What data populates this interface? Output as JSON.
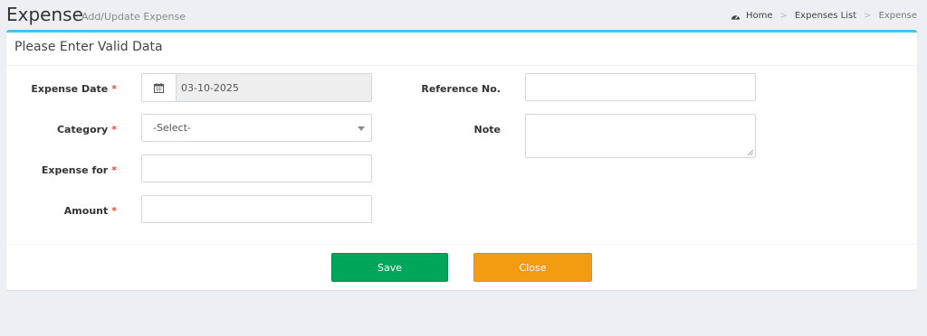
{
  "header": {
    "title": "Expense",
    "subtitle": "Add/Update Expense",
    "breadcrumb": {
      "home": "Home",
      "list": "Expenses List",
      "current": "Expense"
    }
  },
  "form": {
    "box_title": "Please Enter Valid Data",
    "required_mark": "*",
    "expense_date": {
      "label": "Expense Date",
      "value": "03-10-2025"
    },
    "category": {
      "label": "Category",
      "selected": "-Select-"
    },
    "expense_for": {
      "label": "Expense for",
      "value": ""
    },
    "amount": {
      "label": "Amount",
      "value": ""
    },
    "reference_no": {
      "label": "Reference No.",
      "value": ""
    },
    "note": {
      "label": "Note",
      "value": ""
    }
  },
  "buttons": {
    "save": "Save",
    "close": "Close"
  },
  "colors": {
    "accent": "#3cc8ea",
    "save": "#00a65a",
    "close": "#f39c12",
    "required": "#dd4b39"
  }
}
